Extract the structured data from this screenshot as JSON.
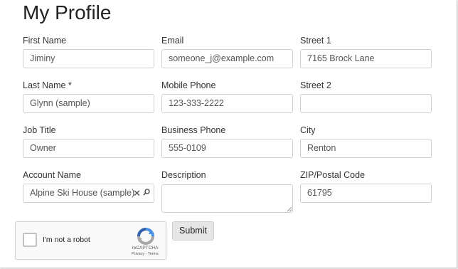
{
  "page": {
    "title": "My Profile"
  },
  "form": {
    "first_name": {
      "label": "First Name",
      "value": "Jiminy"
    },
    "last_name": {
      "label": "Last Name *",
      "value": "Glynn (sample)"
    },
    "job_title": {
      "label": "Job Title",
      "value": "Owner"
    },
    "account_name": {
      "label": "Account Name",
      "value": "Alpine Ski House (sample)",
      "clear_icon": "close-icon",
      "lookup_icon": "search-icon"
    },
    "email": {
      "label": "Email",
      "value": "someone_j@example.com"
    },
    "mobile_phone": {
      "label": "Mobile Phone",
      "value": "123-333-2222"
    },
    "business_phone": {
      "label": "Business Phone",
      "value": "555-0109"
    },
    "description": {
      "label": "Description",
      "value": ""
    },
    "street1": {
      "label": "Street 1",
      "value": "7165 Brock Lane"
    },
    "street2": {
      "label": "Street 2",
      "value": ""
    },
    "city": {
      "label": "City",
      "value": "Renton"
    },
    "zip": {
      "label": "ZIP/Postal Code",
      "value": "61795"
    }
  },
  "captcha": {
    "label": "I'm not a robot",
    "brand": "reCAPTCHA",
    "links": "Privacy - Terms",
    "checked": false
  },
  "actions": {
    "submit_label": "Submit"
  },
  "colors": {
    "field_border": "#cfcfcf",
    "button_bg": "#e6e6e6",
    "captcha_blue": "#4a90e2",
    "captcha_gray": "#a6a6a6"
  }
}
